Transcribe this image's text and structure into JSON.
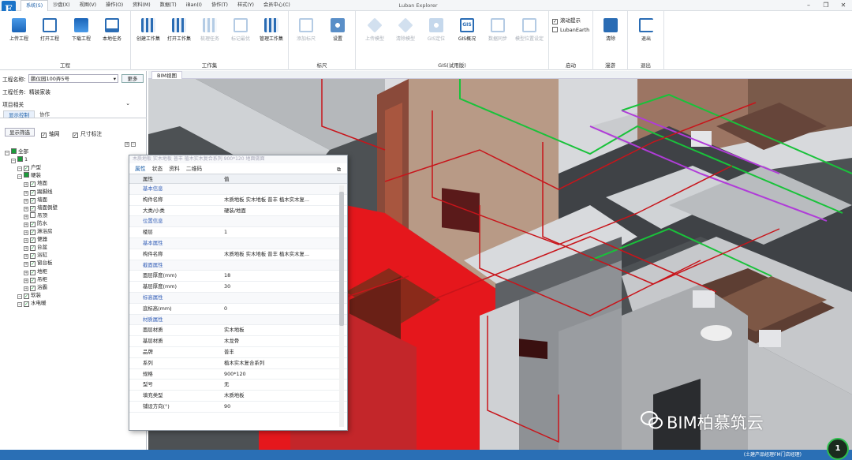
{
  "app": {
    "title": "Luban Explorer",
    "logo": "E"
  },
  "menu_tabs": [
    "系统(S)",
    "沙盘(X)",
    "视图(V)",
    "操作(O)",
    "资料(M)",
    "数据(T)",
    "iBan(I)",
    "协作(T)",
    "样式(Y)",
    "会员中心(C)"
  ],
  "window_controls": {
    "minimize": "–",
    "restore": "❐",
    "close": "✕"
  },
  "ribbon": {
    "groups": [
      {
        "label": "工程",
        "buttons": [
          {
            "label": "上传工程",
            "icon": "upload-icon"
          },
          {
            "label": "打开工程",
            "icon": "open-project-icon"
          },
          {
            "label": "下载工程",
            "icon": "download-icon"
          },
          {
            "label": "本地任务",
            "icon": "local-task-icon"
          }
        ]
      },
      {
        "label": "工作集",
        "buttons": [
          {
            "label": "创建工作集",
            "icon": "create-workset-icon"
          },
          {
            "label": "打开工作集",
            "icon": "open-workset-icon"
          },
          {
            "label": "梳理任务",
            "icon": "task-icon"
          },
          {
            "label": "标记最优",
            "icon": "flag-icon"
          },
          {
            "label": "管理工作集",
            "icon": "manage-workset-icon"
          }
        ]
      },
      {
        "label": "标尺",
        "buttons": [
          {
            "label": "添加标尺",
            "icon": "ruler-icon"
          },
          {
            "label": "设置",
            "icon": "settings-icon"
          }
        ]
      },
      {
        "label": "GIS(试用版)",
        "buttons": [
          {
            "label": "上传模型",
            "icon": "upload-model-icon"
          },
          {
            "label": "清除模型",
            "icon": "clear-model-icon"
          },
          {
            "label": "GIS定位",
            "icon": "gis-locate-icon"
          },
          {
            "label": "GIS概况",
            "icon": "gis-overview-icon"
          },
          {
            "label": "数据同步",
            "icon": "data-sync-icon"
          },
          {
            "label": "模型位置设定",
            "icon": "model-position-icon"
          }
        ]
      },
      {
        "label": "启动",
        "checks": [
          {
            "label": "滚动提示",
            "checked": true
          },
          {
            "label": "LubanEarth",
            "checked": false
          }
        ]
      },
      {
        "label": "漫游",
        "buttons": [
          {
            "label": "清除",
            "icon": "trash-icon"
          }
        ]
      },
      {
        "label": "退出",
        "buttons": [
          {
            "label": "退出",
            "icon": "exit-icon"
          }
        ]
      }
    ]
  },
  "left_panel": {
    "project_name_label": "工程名称:",
    "project_name_value": "鹏仪园100弄5号",
    "more_button": "更多",
    "project_task_label": "工程任务:",
    "project_task_value": "精装家装",
    "related_items_label": "项目相关",
    "tabs": [
      "显示控制",
      "协作"
    ],
    "show_filter_button": "显示筛选",
    "check_axis": "轴网",
    "check_dimension": "尺寸标注",
    "tree": [
      {
        "label": "全部",
        "level": 0,
        "state": "mixed"
      },
      {
        "label": "1",
        "level": 1,
        "state": "mixed"
      },
      {
        "label": "户型",
        "level": 2,
        "state": "on"
      },
      {
        "label": "硬装",
        "level": 2,
        "state": "mixed"
      },
      {
        "label": "地面",
        "level": 3,
        "state": "on"
      },
      {
        "label": "踢脚线",
        "level": 3,
        "state": "on"
      },
      {
        "label": "墙面",
        "level": 3,
        "state": "on"
      },
      {
        "label": "墙面倒壁",
        "level": 3,
        "state": "on"
      },
      {
        "label": "吊顶",
        "level": 3,
        "state": "off"
      },
      {
        "label": "防水",
        "level": 3,
        "state": "on"
      },
      {
        "label": "淋浴房",
        "level": 3,
        "state": "on"
      },
      {
        "label": "便器",
        "level": 3,
        "state": "on"
      },
      {
        "label": "台盆",
        "level": 3,
        "state": "on"
      },
      {
        "label": "浴缸",
        "level": 3,
        "state": "on"
      },
      {
        "label": "窗台板",
        "level": 3,
        "state": "on"
      },
      {
        "label": "地柜",
        "level": 3,
        "state": "on"
      },
      {
        "label": "吊柜",
        "level": 3,
        "state": "on"
      },
      {
        "label": "浴霸",
        "level": 3,
        "state": "on"
      },
      {
        "label": "软装",
        "level": 2,
        "state": "on"
      },
      {
        "label": "水电暖",
        "level": 2,
        "state": "on"
      }
    ]
  },
  "view_tab": "BIM视图",
  "property_window": {
    "title": "木质地板 实木地板 普丰 植木实木复合系列 900*120 地面做面",
    "tabs": [
      "属性",
      "状态",
      "资料",
      "二维码"
    ],
    "col_property": "属性",
    "col_value": "值",
    "rows": [
      {
        "k": "基本信息",
        "v": "",
        "cat": true
      },
      {
        "k": "构件名称",
        "v": "木质地板 实木地板 普丰 植木实木复...",
        "cat": false
      },
      {
        "k": "大类/小类",
        "v": "硬装/地面",
        "cat": false
      },
      {
        "k": "位置信息",
        "v": "",
        "cat": true
      },
      {
        "k": "楼层",
        "v": "1",
        "cat": false
      },
      {
        "k": "基本属性",
        "v": "",
        "cat": true
      },
      {
        "k": "构件名称",
        "v": "木质地板 实木地板 普丰 植木实木复...",
        "cat": false
      },
      {
        "k": "截面属性",
        "v": "",
        "cat": true
      },
      {
        "k": "面层厚度(mm)",
        "v": "18",
        "cat": false
      },
      {
        "k": "基层厚度(mm)",
        "v": "30",
        "cat": false
      },
      {
        "k": "标高属性",
        "v": "",
        "cat": true
      },
      {
        "k": "底标高(mm)",
        "v": "0",
        "cat": false
      },
      {
        "k": "材质属性",
        "v": "",
        "cat": true
      },
      {
        "k": "面层材质",
        "v": "实木地板",
        "cat": false
      },
      {
        "k": "基层材质",
        "v": "木龙骨",
        "cat": false
      },
      {
        "k": "品牌",
        "v": "普丰",
        "cat": false
      },
      {
        "k": "系列",
        "v": "植木实木复合系列",
        "cat": false
      },
      {
        "k": "规格",
        "v": "900*120",
        "cat": false
      },
      {
        "k": "型号",
        "v": "无",
        "cat": false
      },
      {
        "k": "填充类型",
        "v": "木质地板",
        "cat": false
      },
      {
        "k": "铺设方向(°)",
        "v": "90",
        "cat": false
      }
    ]
  },
  "status_bar": {
    "text": "(土建产品经理FM门店经理)"
  },
  "watermark": "BIM柏慕筑云",
  "badge": "1",
  "colors": {
    "accent": "#2a6fb5",
    "floor_red": "#e8141a",
    "wall_grey": "#8c8f93",
    "pipe_green": "#19c23a",
    "pipe_purple": "#b03cd8",
    "pipe_red": "#c8141a"
  }
}
